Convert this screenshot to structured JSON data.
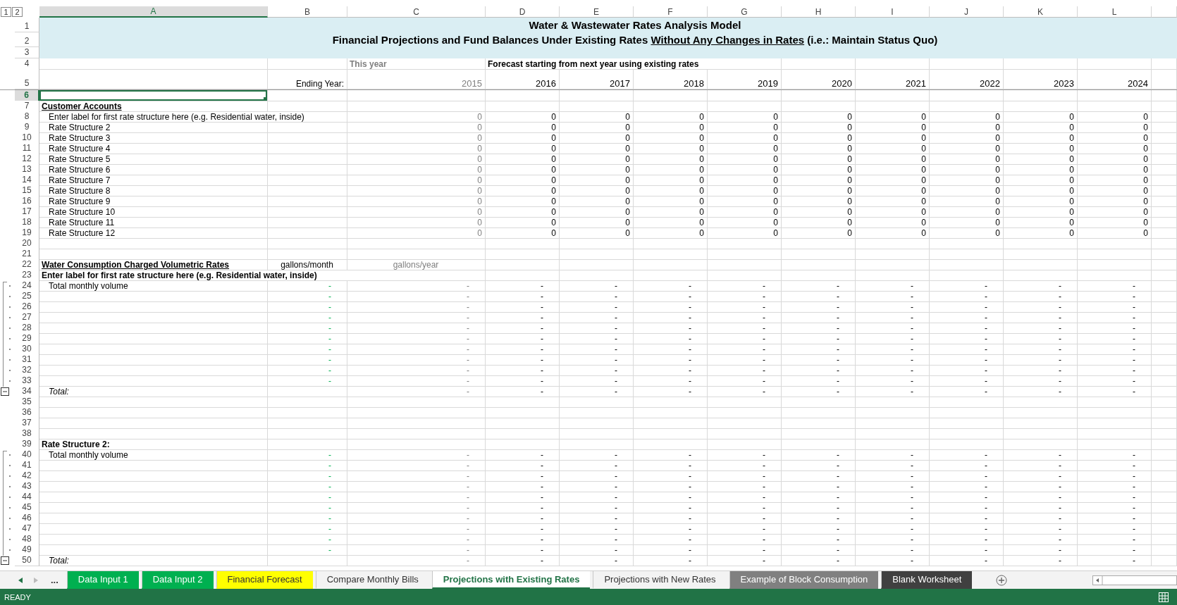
{
  "outline_levels": [
    "1",
    "2"
  ],
  "columns": [
    {
      "letter": "A",
      "selected": true
    },
    {
      "letter": "B",
      "selected": false
    },
    {
      "letter": "C",
      "selected": false
    },
    {
      "letter": "D",
      "selected": false
    },
    {
      "letter": "E",
      "selected": false
    },
    {
      "letter": "F",
      "selected": false
    },
    {
      "letter": "G",
      "selected": false
    },
    {
      "letter": "H",
      "selected": false
    },
    {
      "letter": "I",
      "selected": false
    },
    {
      "letter": "J",
      "selected": false
    },
    {
      "letter": "K",
      "selected": false
    },
    {
      "letter": "L",
      "selected": false
    }
  ],
  "banner": {
    "row_numbers": [
      "1",
      "2",
      "3"
    ],
    "title": "Water & Wastewater Rates Analysis Model",
    "subtitle": [
      {
        "text": "Financial Projections and Fund Balances Under Existing Rates ",
        "underline": false
      },
      {
        "text": "Without Any Changes in Rates",
        "underline": true
      },
      {
        "text": " (i.e.: Maintain Status Quo)",
        "underline": false
      }
    ]
  },
  "rows": [
    {
      "n": "4",
      "kind": "notes",
      "selected": false,
      "cells": [
        null,
        null,
        "This year",
        "Forecast starting from next year using existing rates"
      ]
    },
    {
      "n": "5",
      "kind": "years",
      "selected": false,
      "cells": [
        null,
        "Ending Year:",
        "2015",
        "2016",
        "2017",
        "2018",
        "2019",
        "2020",
        "2021",
        "2022",
        "2023",
        "2024"
      ]
    },
    {
      "n": "6",
      "kind": "blank",
      "selected": true,
      "cells": []
    },
    {
      "n": "7",
      "kind": "heading",
      "selected": false,
      "cells": [
        "Customer Accounts"
      ]
    },
    {
      "n": "8",
      "kind": "account",
      "selected": false,
      "cells": [
        "Enter label for first rate structure here (e.g. Residential water, inside)",
        null,
        "0",
        "0",
        "0",
        "0",
        "0",
        "0",
        "0",
        "0",
        "0",
        "0"
      ]
    },
    {
      "n": "9",
      "kind": "account",
      "selected": false,
      "cells": [
        "Rate Structure 2",
        null,
        "0",
        "0",
        "0",
        "0",
        "0",
        "0",
        "0",
        "0",
        "0",
        "0"
      ]
    },
    {
      "n": "10",
      "kind": "account",
      "selected": false,
      "cells": [
        "Rate Structure 3",
        null,
        "0",
        "0",
        "0",
        "0",
        "0",
        "0",
        "0",
        "0",
        "0",
        "0"
      ]
    },
    {
      "n": "11",
      "kind": "account",
      "selected": false,
      "cells": [
        "Rate Structure 4",
        null,
        "0",
        "0",
        "0",
        "0",
        "0",
        "0",
        "0",
        "0",
        "0",
        "0"
      ]
    },
    {
      "n": "12",
      "kind": "account",
      "selected": false,
      "cells": [
        "Rate Structure 5",
        null,
        "0",
        "0",
        "0",
        "0",
        "0",
        "0",
        "0",
        "0",
        "0",
        "0"
      ]
    },
    {
      "n": "13",
      "kind": "account",
      "selected": false,
      "cells": [
        "Rate Structure 6",
        null,
        "0",
        "0",
        "0",
        "0",
        "0",
        "0",
        "0",
        "0",
        "0",
        "0"
      ]
    },
    {
      "n": "14",
      "kind": "account",
      "selected": false,
      "cells": [
        "Rate Structure 7",
        null,
        "0",
        "0",
        "0",
        "0",
        "0",
        "0",
        "0",
        "0",
        "0",
        "0"
      ]
    },
    {
      "n": "15",
      "kind": "account",
      "selected": false,
      "cells": [
        "Rate Structure 8",
        null,
        "0",
        "0",
        "0",
        "0",
        "0",
        "0",
        "0",
        "0",
        "0",
        "0"
      ]
    },
    {
      "n": "16",
      "kind": "account",
      "selected": false,
      "cells": [
        "Rate Structure 9",
        null,
        "0",
        "0",
        "0",
        "0",
        "0",
        "0",
        "0",
        "0",
        "0",
        "0"
      ]
    },
    {
      "n": "17",
      "kind": "account",
      "selected": false,
      "cells": [
        "Rate Structure 10",
        null,
        "0",
        "0",
        "0",
        "0",
        "0",
        "0",
        "0",
        "0",
        "0",
        "0"
      ]
    },
    {
      "n": "18",
      "kind": "account",
      "selected": false,
      "cells": [
        "Rate Structure 11",
        null,
        "0",
        "0",
        "0",
        "0",
        "0",
        "0",
        "0",
        "0",
        "0",
        "0"
      ]
    },
    {
      "n": "19",
      "kind": "account",
      "selected": false,
      "cells": [
        "Rate Structure 12",
        null,
        "0",
        "0",
        "0",
        "0",
        "0",
        "0",
        "0",
        "0",
        "0",
        "0"
      ]
    },
    {
      "n": "20",
      "kind": "blank",
      "selected": false,
      "cells": []
    },
    {
      "n": "21",
      "kind": "blank",
      "selected": false,
      "cells": []
    },
    {
      "n": "22",
      "kind": "heading",
      "selected": false,
      "cells": [
        "Water Consumption Charged Volumetric Rates",
        "gallons/month",
        "gallons/year"
      ]
    },
    {
      "n": "23",
      "kind": "subheading",
      "selected": false,
      "cells": [
        "Enter label for first rate structure here (e.g. Residential water, inside)"
      ]
    },
    {
      "n": "24",
      "kind": "volume",
      "selected": false,
      "cells": [
        "Total monthly volume",
        "-",
        "-",
        "-",
        "-",
        "-",
        "-",
        "-",
        "-",
        "-",
        "-",
        "-"
      ]
    },
    {
      "n": "25",
      "kind": "volume",
      "selected": false,
      "cells": [
        null,
        "-",
        "-",
        "-",
        "-",
        "-",
        "-",
        "-",
        "-",
        "-",
        "-",
        "-"
      ]
    },
    {
      "n": "26",
      "kind": "volume",
      "selected": false,
      "cells": [
        null,
        "-",
        "-",
        "-",
        "-",
        "-",
        "-",
        "-",
        "-",
        "-",
        "-",
        "-"
      ]
    },
    {
      "n": "27",
      "kind": "volume",
      "selected": false,
      "cells": [
        null,
        "-",
        "-",
        "-",
        "-",
        "-",
        "-",
        "-",
        "-",
        "-",
        "-",
        "-"
      ]
    },
    {
      "n": "28",
      "kind": "volume",
      "selected": false,
      "cells": [
        null,
        "-",
        "-",
        "-",
        "-",
        "-",
        "-",
        "-",
        "-",
        "-",
        "-",
        "-"
      ]
    },
    {
      "n": "29",
      "kind": "volume",
      "selected": false,
      "cells": [
        null,
        "-",
        "-",
        "-",
        "-",
        "-",
        "-",
        "-",
        "-",
        "-",
        "-",
        "-"
      ]
    },
    {
      "n": "30",
      "kind": "volume",
      "selected": false,
      "cells": [
        null,
        "-",
        "-",
        "-",
        "-",
        "-",
        "-",
        "-",
        "-",
        "-",
        "-",
        "-"
      ]
    },
    {
      "n": "31",
      "kind": "volume",
      "selected": false,
      "cells": [
        null,
        "-",
        "-",
        "-",
        "-",
        "-",
        "-",
        "-",
        "-",
        "-",
        "-",
        "-"
      ]
    },
    {
      "n": "32",
      "kind": "volume",
      "selected": false,
      "cells": [
        null,
        "-",
        "-",
        "-",
        "-",
        "-",
        "-",
        "-",
        "-",
        "-",
        "-",
        "-"
      ]
    },
    {
      "n": "33",
      "kind": "volume",
      "selected": false,
      "cells": [
        null,
        "-",
        "-",
        "-",
        "-",
        "-",
        "-",
        "-",
        "-",
        "-",
        "-",
        "-"
      ]
    },
    {
      "n": "34",
      "kind": "total",
      "selected": false,
      "expanded": true,
      "cells": [
        "Total:",
        null,
        "-",
        "-",
        "-",
        "-",
        "-",
        "-",
        "-",
        "-",
        "-",
        "-"
      ]
    },
    {
      "n": "35",
      "kind": "blank",
      "selected": false,
      "cells": []
    },
    {
      "n": "36",
      "kind": "blank",
      "selected": false,
      "cells": []
    },
    {
      "n": "37",
      "kind": "blank",
      "selected": false,
      "cells": []
    },
    {
      "n": "38",
      "kind": "blank",
      "selected": false,
      "cells": []
    },
    {
      "n": "39",
      "kind": "subheading",
      "selected": false,
      "cells": [
        "Rate Structure 2:"
      ]
    },
    {
      "n": "40",
      "kind": "volume",
      "selected": false,
      "cells": [
        "Total monthly volume",
        "-",
        "-",
        "-",
        "-",
        "-",
        "-",
        "-",
        "-",
        "-",
        "-",
        "-"
      ]
    },
    {
      "n": "41",
      "kind": "volume",
      "selected": false,
      "cells": [
        null,
        "-",
        "-",
        "-",
        "-",
        "-",
        "-",
        "-",
        "-",
        "-",
        "-",
        "-"
      ]
    },
    {
      "n": "42",
      "kind": "volume",
      "selected": false,
      "cells": [
        null,
        "-",
        "-",
        "-",
        "-",
        "-",
        "-",
        "-",
        "-",
        "-",
        "-",
        "-"
      ]
    },
    {
      "n": "43",
      "kind": "volume",
      "selected": false,
      "cells": [
        null,
        "-",
        "-",
        "-",
        "-",
        "-",
        "-",
        "-",
        "-",
        "-",
        "-",
        "-"
      ]
    },
    {
      "n": "44",
      "kind": "volume",
      "selected": false,
      "cells": [
        null,
        "-",
        "-",
        "-",
        "-",
        "-",
        "-",
        "-",
        "-",
        "-",
        "-",
        "-"
      ]
    },
    {
      "n": "45",
      "kind": "volume",
      "selected": false,
      "cells": [
        null,
        "-",
        "-",
        "-",
        "-",
        "-",
        "-",
        "-",
        "-",
        "-",
        "-",
        "-"
      ]
    },
    {
      "n": "46",
      "kind": "volume",
      "selected": false,
      "cells": [
        null,
        "-",
        "-",
        "-",
        "-",
        "-",
        "-",
        "-",
        "-",
        "-",
        "-",
        "-"
      ]
    },
    {
      "n": "47",
      "kind": "volume",
      "selected": false,
      "cells": [
        null,
        "-",
        "-",
        "-",
        "-",
        "-",
        "-",
        "-",
        "-",
        "-",
        "-",
        "-"
      ]
    },
    {
      "n": "48",
      "kind": "volume",
      "selected": false,
      "cells": [
        null,
        "-",
        "-",
        "-",
        "-",
        "-",
        "-",
        "-",
        "-",
        "-",
        "-",
        "-"
      ]
    },
    {
      "n": "49",
      "kind": "volume",
      "selected": false,
      "cells": [
        null,
        "-",
        "-",
        "-",
        "-",
        "-",
        "-",
        "-",
        "-",
        "-",
        "-",
        "-"
      ]
    },
    {
      "n": "50",
      "kind": "total",
      "selected": false,
      "expanded": true,
      "cells": [
        "Total:",
        null,
        "-",
        "-",
        "-",
        "-",
        "-",
        "-",
        "-",
        "-",
        "-",
        "-"
      ]
    }
  ],
  "sheet_tabs": {
    "more": "...",
    "tabs": [
      {
        "label": "Data Input 1",
        "selected": false,
        "color": "#00b050"
      },
      {
        "label": "Data Input 2",
        "selected": false,
        "color": "#00b050"
      },
      {
        "label": "Financial Forecast",
        "selected": false,
        "color": "#ffff00"
      },
      {
        "label": "Compare Monthly Bills",
        "selected": false
      },
      {
        "label": "Projections with Existing Rates",
        "selected": true
      },
      {
        "label": "Projections with New Rates",
        "selected": false
      },
      {
        "label": "Example of Block Consumption",
        "selected": false,
        "color": "#808080"
      },
      {
        "label": "Blank Worksheet",
        "selected": false,
        "color": "#404040"
      }
    ]
  },
  "status_bar": {
    "text": "READY"
  }
}
